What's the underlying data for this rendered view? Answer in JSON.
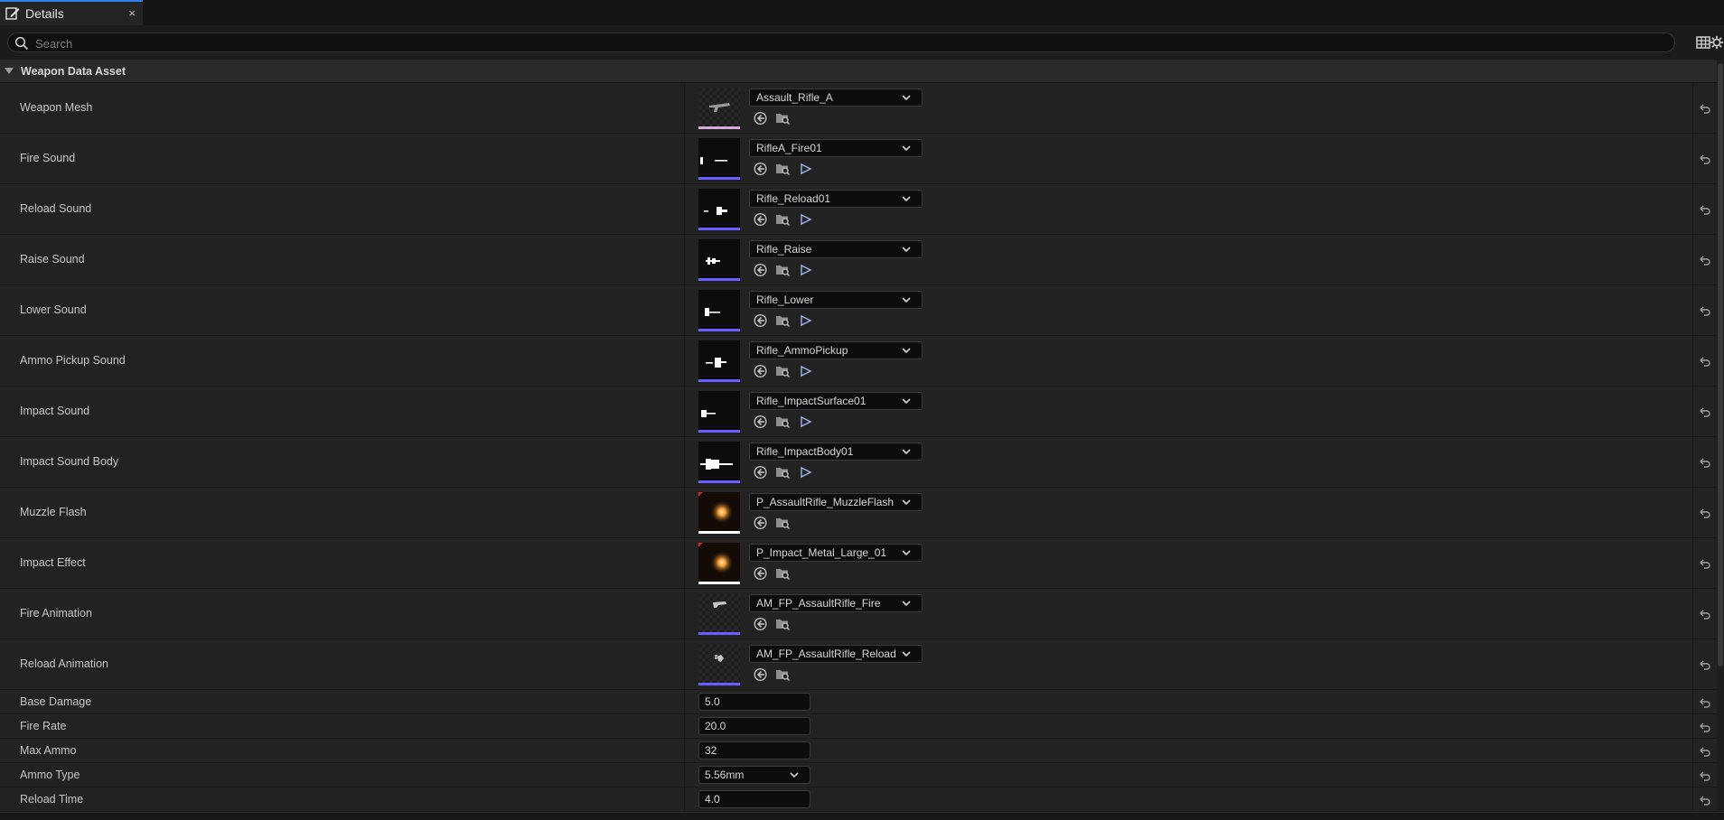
{
  "tab": {
    "title": "Details",
    "close": "×"
  },
  "search": {
    "placeholder": "Search"
  },
  "category": {
    "label": "Weapon Data Asset"
  },
  "asset_rows": [
    {
      "name": "Weapon Mesh",
      "value": "Assault_Rifle_A",
      "kind": "mesh",
      "underline": "#d6a7d8",
      "play": false
    },
    {
      "name": "Fire Sound",
      "value": "RifleA_Fire01",
      "kind": "sound",
      "underline": "#6a5cff",
      "play": true
    },
    {
      "name": "Reload Sound",
      "value": "Rifle_Reload01",
      "kind": "sound",
      "underline": "#6a5cff",
      "play": true
    },
    {
      "name": "Raise Sound",
      "value": "Rifle_Raise",
      "kind": "sound",
      "underline": "#6a5cff",
      "play": true
    },
    {
      "name": "Lower Sound",
      "value": "Rifle_Lower",
      "kind": "sound",
      "underline": "#6a5cff",
      "play": true
    },
    {
      "name": "Ammo Pickup Sound",
      "value": "Rifle_AmmoPickup",
      "kind": "sound",
      "underline": "#6a5cff",
      "play": true
    },
    {
      "name": "Impact Sound",
      "value": "Rifle_ImpactSurface01",
      "kind": "sound",
      "underline": "#6a5cff",
      "play": true
    },
    {
      "name": "Impact Sound Body",
      "value": "Rifle_ImpactBody01",
      "kind": "sound",
      "underline": "#6a5cff",
      "play": true
    },
    {
      "name": "Muzzle Flash",
      "value": "P_AssaultRifle_MuzzleFlash",
      "kind": "particle",
      "underline": "#ffffff",
      "play": false
    },
    {
      "name": "Impact Effect",
      "value": "P_Impact_Metal_Large_01",
      "kind": "particle",
      "underline": "#ffffff",
      "play": false
    },
    {
      "name": "Fire Animation",
      "value": "AM_FP_AssaultRifle_Fire",
      "kind": "anim",
      "underline": "#6a5cff",
      "play": false
    },
    {
      "name": "Reload Animation",
      "value": "AM_FP_AssaultRifle_Reload",
      "kind": "anim",
      "underline": "#6a5cff",
      "play": false
    }
  ],
  "value_rows": [
    {
      "name": "Base Damage",
      "value": "5.0",
      "kind": "number"
    },
    {
      "name": "Fire Rate",
      "value": "20.0",
      "kind": "number"
    },
    {
      "name": "Max Ammo",
      "value": "32",
      "kind": "number"
    },
    {
      "name": "Ammo Type",
      "value": "5.56mm",
      "kind": "enum"
    },
    {
      "name": "Reload Time",
      "value": "4.0",
      "kind": "number"
    }
  ],
  "colors": {
    "accent": "#2f7ff0",
    "background": "#1b1b1b",
    "row": "#222222",
    "header": "#2a2a2a"
  },
  "icons": [
    "edit-icon",
    "close-icon",
    "search-icon",
    "table-view-icon",
    "settings-icon",
    "reset-to-default-icon",
    "use-selected-icon",
    "browse-icon",
    "play-icon",
    "chevron-down-icon"
  ]
}
